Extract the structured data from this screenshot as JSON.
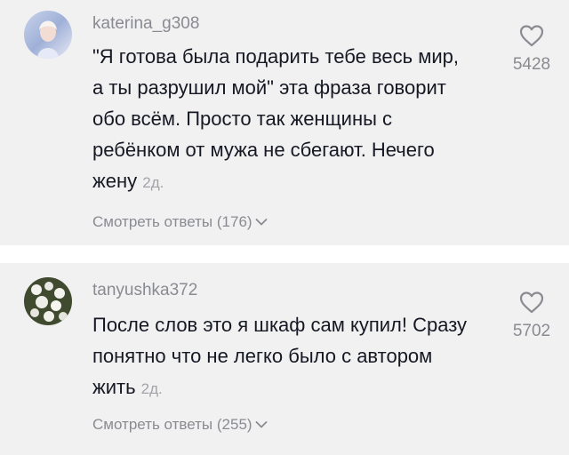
{
  "comments": [
    {
      "username": "katerina_g308",
      "text": "\"Я готова была подарить тебе весь мир, а ты разрушил мой\" эта фраза говорит обо всём. Просто так женщины с ребёнком от мужа не сбегают. Нечего жену",
      "age": "2д.",
      "replies_label": "Смотреть ответы (176)",
      "likes": "5428"
    },
    {
      "username": "tanyushka372",
      "text": "После слов это я шкаф сам купил! Сразу понятно что не легко было с автором жить",
      "age": "2д.",
      "replies_label": "Смотреть ответы (255)",
      "likes": "5702"
    }
  ],
  "colors": {
    "card_background": "#f1f1f2",
    "text": "#161823",
    "muted": "#8a8b91"
  },
  "icons": [
    "heart-outline-icon",
    "chevron-down-icon",
    "avatar"
  ]
}
